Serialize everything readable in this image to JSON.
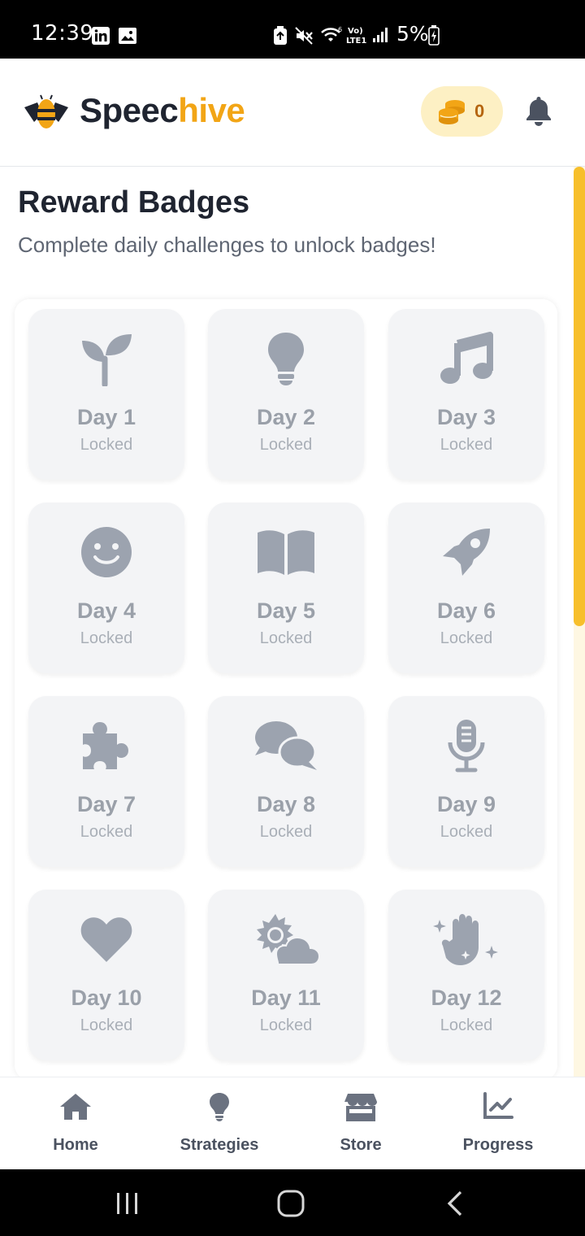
{
  "status_bar": {
    "time": "12:39",
    "battery_percent": "5%",
    "icons": [
      "linkedin-icon",
      "gallery-icon",
      "battery-saver-icon",
      "mute-icon",
      "wifi-icon",
      "volte-icon",
      "signal-icon",
      "battery-charging-icon"
    ]
  },
  "header": {
    "brand_part1": "Speec",
    "brand_part2": "hive",
    "coins": "0",
    "brand_color": "#f2a516"
  },
  "page": {
    "title": "Reward Badges",
    "subtitle": "Complete daily challenges to unlock badges!"
  },
  "badges": [
    {
      "day": "Day 1",
      "status": "Locked",
      "icon": "seedling-icon"
    },
    {
      "day": "Day 2",
      "status": "Locked",
      "icon": "lightbulb-icon"
    },
    {
      "day": "Day 3",
      "status": "Locked",
      "icon": "music-note-icon"
    },
    {
      "day": "Day 4",
      "status": "Locked",
      "icon": "smiley-icon"
    },
    {
      "day": "Day 5",
      "status": "Locked",
      "icon": "open-book-icon"
    },
    {
      "day": "Day 6",
      "status": "Locked",
      "icon": "rocket-icon"
    },
    {
      "day": "Day 7",
      "status": "Locked",
      "icon": "puzzle-icon"
    },
    {
      "day": "Day 8",
      "status": "Locked",
      "icon": "chat-bubbles-icon"
    },
    {
      "day": "Day 9",
      "status": "Locked",
      "icon": "microphone-icon"
    },
    {
      "day": "Day 10",
      "status": "Locked",
      "icon": "heart-icon"
    },
    {
      "day": "Day 11",
      "status": "Locked",
      "icon": "sun-cloud-icon"
    },
    {
      "day": "Day 12",
      "status": "Locked",
      "icon": "sparkle-hand-icon"
    }
  ],
  "bottom_nav": [
    {
      "label": "Home",
      "icon": "home-icon"
    },
    {
      "label": "Strategies",
      "icon": "lightbulb-icon"
    },
    {
      "label": "Store",
      "icon": "store-icon"
    },
    {
      "label": "Progress",
      "icon": "chart-line-icon"
    }
  ],
  "colors": {
    "badge_bg": "#f3f4f6",
    "badge_icon": "#9ca3af",
    "scroll_thumb": "#f7bf2b",
    "coin_pill": "#fdf0c4"
  }
}
